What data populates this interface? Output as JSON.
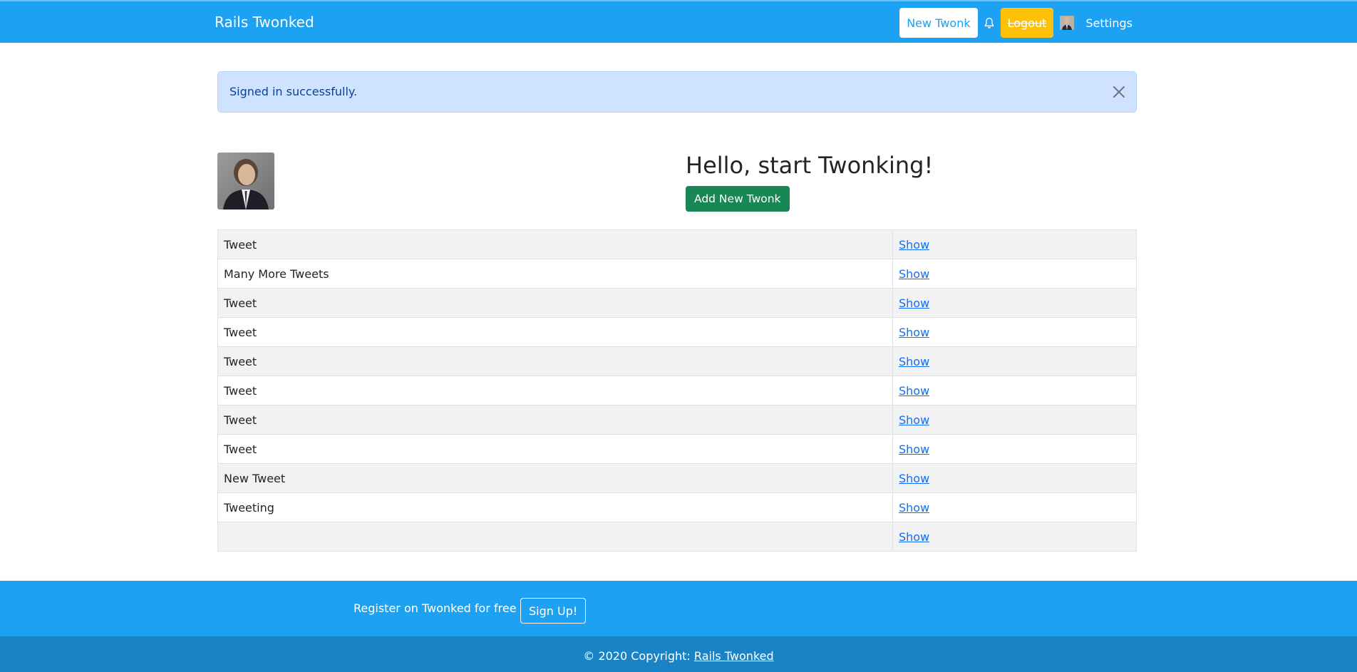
{
  "navbar": {
    "brand": "Rails Twonked",
    "new_twonk": "New Twonk",
    "logout": "Logout",
    "settings": "Settings"
  },
  "alert": {
    "message": "Signed in successfully."
  },
  "hero": {
    "heading": "Hello, start Twonking!",
    "add_button": "Add New Twonk"
  },
  "tweets": [
    {
      "text": "Tweet",
      "action": "Show"
    },
    {
      "text": "Many More Tweets",
      "action": "Show"
    },
    {
      "text": "Tweet",
      "action": "Show"
    },
    {
      "text": "Tweet",
      "action": "Show"
    },
    {
      "text": "Tweet",
      "action": "Show"
    },
    {
      "text": "Tweet",
      "action": "Show"
    },
    {
      "text": "Tweet",
      "action": "Show"
    },
    {
      "text": "Tweet",
      "action": "Show"
    },
    {
      "text": "New Tweet",
      "action": "Show"
    },
    {
      "text": "Tweeting",
      "action": "Show"
    },
    {
      "text": "",
      "action": "Show"
    }
  ],
  "footer": {
    "register_text": "Register on Twonked for free",
    "signup_button": "Sign Up!",
    "copyright_prefix": "© 2020 Copyright:",
    "copyright_link": "Rails Twonked"
  },
  "colors": {
    "primary": "#1da1f2",
    "footer_dark": "#1a83c6",
    "logout": "#ffc107",
    "success": "#198754",
    "link": "#0d6efd",
    "alert_bg": "#cfe2ff"
  },
  "icons": {
    "bell": "bell-icon",
    "close": "close-icon"
  }
}
